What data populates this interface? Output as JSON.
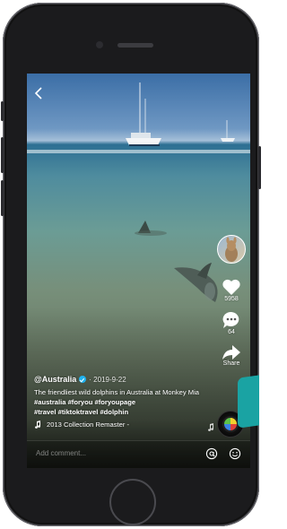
{
  "header": {
    "back_icon": "chevron-left-icon"
  },
  "rail": {
    "avatar": "avatar",
    "likes": "5958",
    "comments": "64",
    "share_label": "Share"
  },
  "post": {
    "username": "@Australia",
    "date": "· 2019-9-22",
    "description_text": "The friendliest wild dolphins in Australia at Monkey Mia ",
    "hashtags_line1": "#australia #foryou #foryoupage",
    "hashtags_line2": "#travel #tiktoktravel #dolphin",
    "music": "2013 Collection Remaster -"
  },
  "comment_bar": {
    "placeholder": "Add comment...",
    "at_icon": "at-icon",
    "emoji_icon": "emoji-icon"
  },
  "colors": {
    "accent_teal": "#1aa3a3",
    "verified_blue": "#20b3f0"
  }
}
